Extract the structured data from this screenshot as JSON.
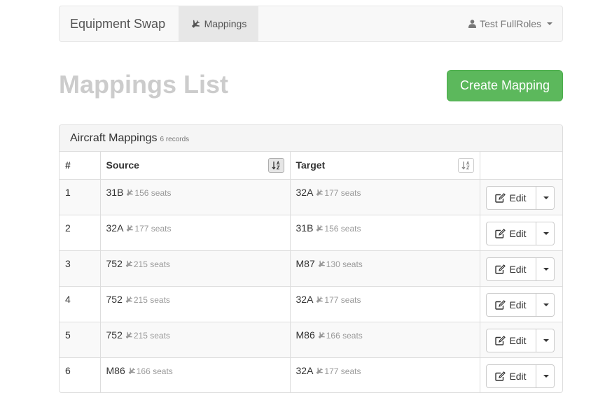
{
  "navbar": {
    "brand": "Equipment Swap",
    "tab_mappings": "Mappings",
    "user": "Test FullRoles"
  },
  "header": {
    "title": "Mappings List",
    "create_button": "Create Mapping"
  },
  "panel": {
    "title": "Aircraft Mappings",
    "count": "6 records",
    "columns": {
      "num": "#",
      "source": "Source",
      "target": "Target"
    },
    "rows": [
      {
        "num": "1",
        "source_code": "31B",
        "source_seats": "156 seats",
        "target_code": "32A",
        "target_seats": "177 seats",
        "edit": "Edit"
      },
      {
        "num": "2",
        "source_code": "32A",
        "source_seats": "177 seats",
        "target_code": "31B",
        "target_seats": "156 seats",
        "edit": "Edit"
      },
      {
        "num": "3",
        "source_code": "752",
        "source_seats": "215 seats",
        "target_code": "M87",
        "target_seats": "130 seats",
        "edit": "Edit"
      },
      {
        "num": "4",
        "source_code": "752",
        "source_seats": "215 seats",
        "target_code": "32A",
        "target_seats": "177 seats",
        "edit": "Edit"
      },
      {
        "num": "5",
        "source_code": "752",
        "source_seats": "215 seats",
        "target_code": "M86",
        "target_seats": "166 seats",
        "edit": "Edit"
      },
      {
        "num": "6",
        "source_code": "M86",
        "source_seats": "166 seats",
        "target_code": "32A",
        "target_seats": "177 seats",
        "edit": "Edit"
      }
    ]
  },
  "icons": {
    "nav_tab": "plane-icon",
    "user": "user-icon",
    "sort": "sort-alpha-icon",
    "edit": "edit-icon",
    "dropdown": "caret-down-icon"
  },
  "colors": {
    "primary_success": "#5cb85c",
    "title_muted": "#cccccc",
    "navbar_bg": "#f8f8f8",
    "active_tab_bg": "#e7e7e7"
  }
}
